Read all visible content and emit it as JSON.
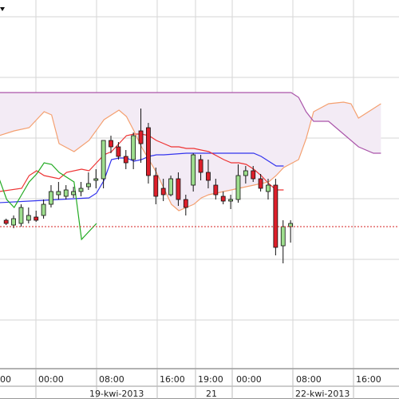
{
  "chart_data": {
    "type": "candlestick",
    "title": "",
    "xlabel": "",
    "ylabel": "",
    "grid": true,
    "legend": "none",
    "ylim": [
      0,
      100
    ],
    "price_line": 41,
    "x_ticks": [
      "00",
      "00:00",
      "08:00",
      "16:00",
      "19:00",
      "00:00",
      "08:00",
      "16:00"
    ],
    "date_labels": [
      "19-kwi-2013",
      "21",
      "22-kwi-2013"
    ],
    "candles": [
      {
        "x": 0.5,
        "o": 42,
        "h": 43,
        "l": 39,
        "c": 40
      },
      {
        "x": 1.5,
        "o": 39,
        "h": 45,
        "l": 37,
        "c": 43
      },
      {
        "x": 2.5,
        "o": 40,
        "h": 52,
        "l": 38,
        "c": 50
      },
      {
        "x": 3.5,
        "o": 42,
        "h": 50,
        "l": 40,
        "c": 45
      },
      {
        "x": 4.5,
        "o": 44,
        "h": 48,
        "l": 41,
        "c": 42
      },
      {
        "x": 5.5,
        "o": 45,
        "h": 55,
        "l": 43,
        "c": 52
      },
      {
        "x": 6.5,
        "o": 52,
        "h": 64,
        "l": 50,
        "c": 60
      },
      {
        "x": 7.5,
        "o": 58,
        "h": 66,
        "l": 55,
        "c": 60
      },
      {
        "x": 8.5,
        "o": 57,
        "h": 64,
        "l": 55,
        "c": 61
      },
      {
        "x": 9.5,
        "o": 58,
        "h": 63,
        "l": 56,
        "c": 60
      },
      {
        "x": 10.5,
        "o": 60,
        "h": 66,
        "l": 57,
        "c": 62
      },
      {
        "x": 11.5,
        "o": 63,
        "h": 72,
        "l": 61,
        "c": 65
      },
      {
        "x": 12.5,
        "o": 67,
        "h": 74,
        "l": 62,
        "c": 68
      },
      {
        "x": 13.5,
        "o": 68,
        "h": 90,
        "l": 62,
        "c": 92
      },
      {
        "x": 14.5,
        "o": 92,
        "h": 95,
        "l": 84,
        "c": 88
      },
      {
        "x": 15.5,
        "o": 88,
        "h": 91,
        "l": 80,
        "c": 82
      },
      {
        "x": 16.5,
        "o": 82,
        "h": 86,
        "l": 74,
        "c": 78
      },
      {
        "x": 17.5,
        "o": 80,
        "h": 97,
        "l": 74,
        "c": 95
      },
      {
        "x": 18.5,
        "o": 98,
        "h": 112,
        "l": 78,
        "c": 90
      },
      {
        "x": 19.5,
        "o": 100,
        "h": 103,
        "l": 65,
        "c": 70
      },
      {
        "x": 20.5,
        "o": 70,
        "h": 75,
        "l": 52,
        "c": 57
      },
      {
        "x": 21.5,
        "o": 62,
        "h": 68,
        "l": 54,
        "c": 58
      },
      {
        "x": 22.5,
        "o": 58,
        "h": 70,
        "l": 57,
        "c": 68
      },
      {
        "x": 23.5,
        "o": 68,
        "h": 72,
        "l": 51,
        "c": 55
      },
      {
        "x": 24.5,
        "o": 55,
        "h": 58,
        "l": 45,
        "c": 50
      },
      {
        "x": 25.5,
        "o": 64,
        "h": 84,
        "l": 60,
        "c": 83
      },
      {
        "x": 26.5,
        "o": 80,
        "h": 83,
        "l": 67,
        "c": 72
      },
      {
        "x": 27.5,
        "o": 72,
        "h": 80,
        "l": 62,
        "c": 67
      },
      {
        "x": 28.5,
        "o": 64,
        "h": 68,
        "l": 55,
        "c": 58
      },
      {
        "x": 29.5,
        "o": 57,
        "h": 60,
        "l": 52,
        "c": 54
      },
      {
        "x": 30.5,
        "o": 54,
        "h": 58,
        "l": 49,
        "c": 55
      },
      {
        "x": 31.5,
        "o": 55,
        "h": 77,
        "l": 53,
        "c": 70
      },
      {
        "x": 32.5,
        "o": 70,
        "h": 76,
        "l": 65,
        "c": 73
      },
      {
        "x": 33.5,
        "o": 73,
        "h": 76,
        "l": 66,
        "c": 68
      },
      {
        "x": 34.5,
        "o": 68,
        "h": 71,
        "l": 60,
        "c": 62
      },
      {
        "x": 35.5,
        "o": 60,
        "h": 68,
        "l": 55,
        "c": 64
      },
      {
        "x": 36.5,
        "o": 64,
        "h": 68,
        "l": 20,
        "c": 25
      },
      {
        "x": 37.5,
        "o": 26,
        "h": 42,
        "l": 15,
        "c": 38
      },
      {
        "x": 38.5,
        "o": 38,
        "h": 42,
        "l": 28,
        "c": 40
      }
    ],
    "series": [
      {
        "color": "#3333ee",
        "points": [
          [
            0,
            53
          ],
          [
            4,
            54
          ],
          [
            8,
            55
          ],
          [
            12,
            56
          ],
          [
            13,
            59
          ],
          [
            14,
            67
          ],
          [
            15,
            80
          ],
          [
            16,
            81
          ],
          [
            17,
            81
          ],
          [
            18,
            79
          ],
          [
            19,
            80
          ],
          [
            20,
            82
          ],
          [
            21,
            83
          ],
          [
            22,
            83
          ],
          [
            25,
            84
          ],
          [
            26,
            84
          ],
          [
            30,
            84
          ],
          [
            34,
            84
          ],
          [
            35,
            82
          ],
          [
            37,
            76
          ],
          [
            38,
            76
          ]
        ]
      },
      {
        "color": "#ee3333",
        "points": [
          [
            0,
            60
          ],
          [
            3,
            62
          ],
          [
            4,
            70
          ],
          [
            5,
            73
          ],
          [
            6,
            70
          ],
          [
            8,
            68
          ],
          [
            9,
            72
          ],
          [
            11,
            74
          ],
          [
            12,
            73
          ],
          [
            13,
            78
          ],
          [
            14,
            83
          ],
          [
            15,
            85
          ],
          [
            16,
            90
          ],
          [
            17,
            95
          ],
          [
            18,
            96
          ],
          [
            19,
            96
          ],
          [
            20,
            95
          ],
          [
            21,
            92
          ],
          [
            22,
            90
          ],
          [
            23,
            88
          ],
          [
            24,
            88
          ],
          [
            25,
            87
          ],
          [
            26,
            87
          ],
          [
            28,
            85
          ],
          [
            30,
            80
          ],
          [
            31,
            78
          ],
          [
            32,
            78
          ],
          [
            33,
            77
          ],
          [
            34,
            74
          ],
          [
            35,
            70
          ],
          [
            36,
            65
          ],
          [
            37,
            61
          ],
          [
            38,
            61
          ]
        ]
      },
      {
        "color": "#22aa22",
        "points": [
          [
            0,
            68
          ],
          [
            1,
            55
          ],
          [
            2,
            50
          ],
          [
            3,
            58
          ],
          [
            4,
            66
          ],
          [
            5,
            71
          ],
          [
            6,
            78
          ],
          [
            7,
            77
          ],
          [
            8,
            72
          ],
          [
            10,
            66
          ],
          [
            11,
            30
          ],
          [
            12,
            35
          ],
          [
            13,
            40
          ]
        ]
      },
      {
        "color": "#f4a070",
        "points": [
          [
            0,
            95
          ],
          [
            2,
            98
          ],
          [
            4,
            100
          ],
          [
            6,
            110
          ],
          [
            7,
            108
          ],
          [
            8,
            90
          ],
          [
            10,
            85
          ],
          [
            12,
            92
          ],
          [
            14,
            105
          ],
          [
            16,
            111
          ],
          [
            17,
            107
          ],
          [
            18,
            98
          ],
          [
            19,
            88
          ],
          [
            20,
            80
          ],
          [
            21,
            72
          ],
          [
            22,
            62
          ],
          [
            23,
            52
          ],
          [
            24,
            48
          ],
          [
            25,
            50
          ],
          [
            26,
            52
          ],
          [
            27,
            56
          ],
          [
            28,
            58
          ],
          [
            30,
            60
          ],
          [
            32,
            62
          ],
          [
            34,
            64
          ],
          [
            36,
            66
          ],
          [
            37,
            70
          ],
          [
            38,
            75
          ],
          [
            40,
            80
          ],
          [
            41,
            93
          ],
          [
            42,
            110
          ],
          [
            44,
            115
          ],
          [
            46,
            116
          ],
          [
            47,
            115
          ],
          [
            48,
            106
          ],
          [
            50,
            112
          ],
          [
            51,
            115
          ]
        ]
      },
      {
        "color": "#aa55aa",
        "points": [
          [
            0,
            122
          ],
          [
            2,
            122
          ],
          [
            4,
            122
          ],
          [
            10,
            122
          ],
          [
            20,
            122
          ],
          [
            30,
            122
          ],
          [
            39,
            122
          ],
          [
            40,
            119
          ],
          [
            41,
            110
          ],
          [
            42,
            104
          ],
          [
            44,
            104
          ],
          [
            46,
            96
          ],
          [
            48,
            88
          ],
          [
            50,
            84
          ],
          [
            51,
            84
          ]
        ]
      }
    ],
    "cloud": {
      "top": [
        [
          0,
          122
        ],
        [
          4,
          122
        ],
        [
          8,
          122
        ],
        [
          12,
          122
        ],
        [
          16,
          122
        ],
        [
          20,
          122
        ],
        [
          24,
          122
        ],
        [
          28,
          122
        ],
        [
          32,
          122
        ],
        [
          36,
          122
        ],
        [
          39,
          122
        ],
        [
          40,
          119
        ],
        [
          41,
          110
        ],
        [
          42,
          104
        ],
        [
          44,
          104
        ],
        [
          46,
          96
        ],
        [
          48,
          88
        ],
        [
          50,
          84
        ],
        [
          51,
          84
        ]
      ],
      "bottom": [
        [
          0,
          95
        ],
        [
          2,
          98
        ],
        [
          4,
          100
        ],
        [
          6,
          110
        ],
        [
          7,
          108
        ],
        [
          8,
          90
        ],
        [
          10,
          85
        ],
        [
          12,
          92
        ],
        [
          14,
          105
        ],
        [
          16,
          111
        ],
        [
          17,
          107
        ],
        [
          18,
          98
        ],
        [
          19,
          88
        ],
        [
          20,
          80
        ],
        [
          21,
          72
        ],
        [
          22,
          62
        ],
        [
          23,
          52
        ],
        [
          24,
          48
        ],
        [
          25,
          50
        ],
        [
          26,
          52
        ],
        [
          27,
          56
        ],
        [
          28,
          58
        ],
        [
          30,
          60
        ],
        [
          32,
          62
        ],
        [
          34,
          64
        ],
        [
          36,
          66
        ],
        [
          37,
          70
        ],
        [
          38,
          75
        ],
        [
          40,
          80
        ],
        [
          41,
          93
        ],
        [
          42,
          110
        ],
        [
          44,
          115
        ],
        [
          46,
          116
        ],
        [
          47,
          115
        ],
        [
          48,
          106
        ],
        [
          50,
          112
        ],
        [
          51,
          115
        ]
      ]
    },
    "colors": {
      "up": "#9ede8e",
      "down": "#dd1f2a",
      "wick": "#111111",
      "cloud_fill": "#f3ebf5",
      "grid": "#d6d6d6",
      "price_line": "#d62020"
    }
  }
}
